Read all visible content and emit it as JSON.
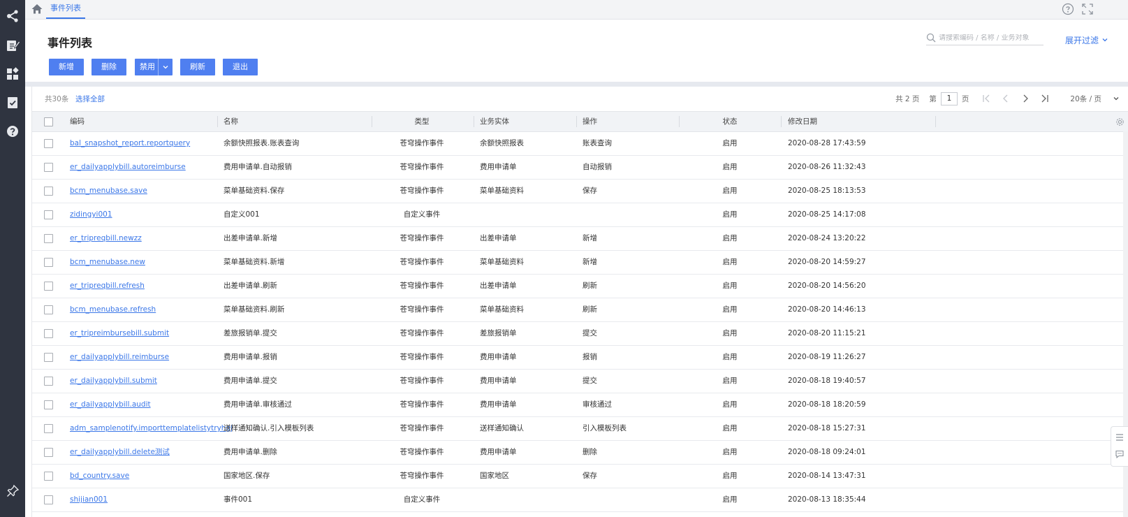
{
  "sidebar": {
    "icons": [
      "share-nodes-icon",
      "edit-doc-icon",
      "apps-grid-icon",
      "task-check-icon",
      "help-circle-icon",
      "pin-icon"
    ]
  },
  "topbar": {
    "tab_label": "事件列表"
  },
  "page": {
    "title": "事件列表"
  },
  "search": {
    "placeholder": "请搜索编码 / 名称 / 业务对象"
  },
  "filter": {
    "label": "展开过滤"
  },
  "toolbar": {
    "add_label": "新增",
    "delete_label": "删除",
    "disable_label": "禁用",
    "refresh_label": "刷新",
    "exit_label": "退出"
  },
  "list_info": {
    "total": "共30条",
    "select_all": "选择全部"
  },
  "pager": {
    "total_pages": "共 2 页",
    "page_prefix": "第",
    "current_page": "1",
    "page_suffix": "页",
    "page_size": "20条 / 页"
  },
  "table": {
    "headers": {
      "code": "编码",
      "name": "名称",
      "type": "类型",
      "entity": "业务实体",
      "operation": "操作",
      "status": "状态",
      "modified": "修改日期"
    },
    "rows": [
      {
        "code": "bal_snapshot_report.reportquery",
        "name": "余额快照报表.账表查询",
        "type": "苍穹操作事件",
        "entity": "余额快照报表",
        "operation": "账表查询",
        "status": "启用",
        "modified": "2020-08-28 17:43:59"
      },
      {
        "code": "er_dailyapplybill.autoreimburse",
        "name": "费用申请单.自动报销",
        "type": "苍穹操作事件",
        "entity": "费用申请单",
        "operation": "自动报销",
        "status": "启用",
        "modified": "2020-08-26 11:32:43"
      },
      {
        "code": "bcm_menubase.save",
        "name": "菜单基础资料.保存",
        "type": "苍穹操作事件",
        "entity": "菜单基础资料",
        "operation": "保存",
        "status": "启用",
        "modified": "2020-08-25 18:13:53"
      },
      {
        "code": "zidingyi001",
        "name": "自定义001",
        "type": "自定义事件",
        "entity": "",
        "operation": "",
        "status": "启用",
        "modified": "2020-08-25 14:17:08"
      },
      {
        "code": "er_tripreqbill.newzz",
        "name": "出差申请单.新增",
        "type": "苍穹操作事件",
        "entity": "出差申请单",
        "operation": "新增",
        "status": "启用",
        "modified": "2020-08-24 13:20:22"
      },
      {
        "code": "bcm_menubase.new",
        "name": "菜单基础资料.新增",
        "type": "苍穹操作事件",
        "entity": "菜单基础资料",
        "operation": "新增",
        "status": "启用",
        "modified": "2020-08-20 14:59:27"
      },
      {
        "code": "er_tripreqbill.refresh",
        "name": "出差申请单.刷新",
        "type": "苍穹操作事件",
        "entity": "出差申请单",
        "operation": "刷新",
        "status": "启用",
        "modified": "2020-08-20 14:56:20"
      },
      {
        "code": "bcm_menubase.refresh",
        "name": "菜单基础资料.刷新",
        "type": "苍穹操作事件",
        "entity": "菜单基础资料",
        "operation": "刷新",
        "status": "启用",
        "modified": "2020-08-20 14:46:13"
      },
      {
        "code": "er_tripreimbursebill.submit",
        "name": "差旅报销单.提交",
        "type": "苍穹操作事件",
        "entity": "差旅报销单",
        "operation": "提交",
        "status": "启用",
        "modified": "2020-08-20 11:15:21"
      },
      {
        "code": "er_dailyapplybill.reimburse",
        "name": "费用申请单.报销",
        "type": "苍穹操作事件",
        "entity": "费用申请单",
        "operation": "报销",
        "status": "启用",
        "modified": "2020-08-19 11:26:27"
      },
      {
        "code": "er_dailyapplybill.submit",
        "name": "费用申请单.提交",
        "type": "苍穹操作事件",
        "entity": "费用申请单",
        "operation": "提交",
        "status": "启用",
        "modified": "2020-08-18 19:40:57"
      },
      {
        "code": "er_dailyapplybill.audit",
        "name": "费用申请单.审核通过",
        "type": "苍穹操作事件",
        "entity": "费用申请单",
        "operation": "审核通过",
        "status": "启用",
        "modified": "2020-08-18 18:20:59"
      },
      {
        "code": "adm_samplenotify.importtemplatelistytryhgj",
        "name": "送样通知确认.引入模板列表",
        "type": "苍穹操作事件",
        "entity": "送样通知确认",
        "operation": "引入模板列表",
        "status": "启用",
        "modified": "2020-08-18 15:27:31"
      },
      {
        "code": "er_dailyapplybill.delete测试",
        "name": "费用申请单.删除",
        "type": "苍穹操作事件",
        "entity": "费用申请单",
        "operation": "删除",
        "status": "启用",
        "modified": "2020-08-18 09:24:01"
      },
      {
        "code": "bd_country.save",
        "name": "国家地区.保存",
        "type": "苍穹操作事件",
        "entity": "国家地区",
        "operation": "保存",
        "status": "启用",
        "modified": "2020-08-14 13:47:31"
      },
      {
        "code": "shijian001",
        "name": "事件001",
        "type": "自定义事件",
        "entity": "",
        "operation": "",
        "status": "启用",
        "modified": "2020-08-13 18:35:44"
      }
    ]
  },
  "colors": {
    "accent": "#3b77e8",
    "button": "#4f7ff0",
    "sidebar": "#2f3440"
  }
}
